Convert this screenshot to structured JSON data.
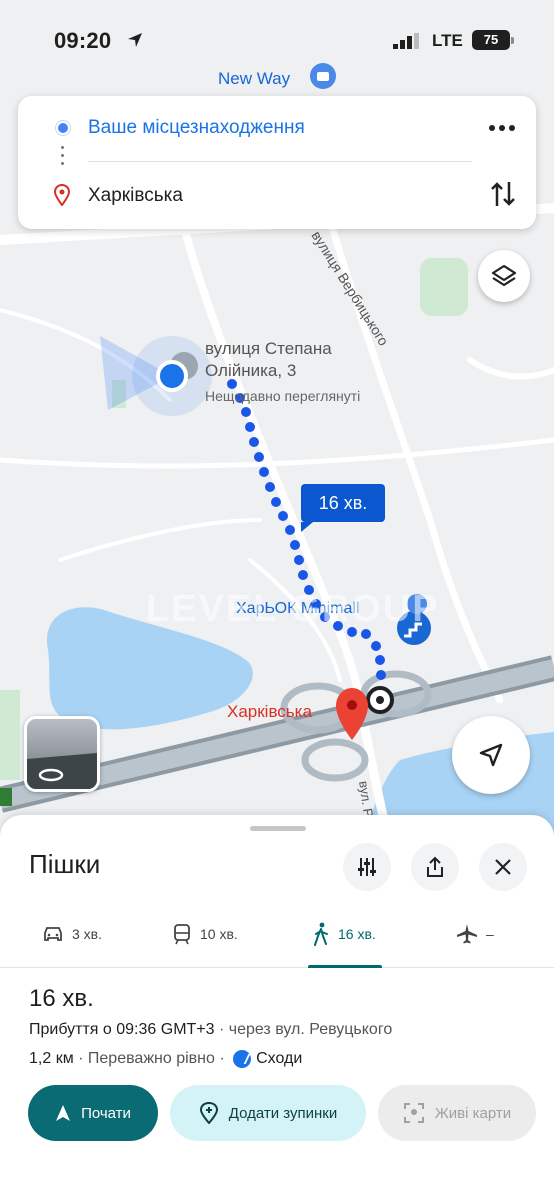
{
  "status_bar": {
    "time": "09:20",
    "network": "LTE",
    "battery": "75"
  },
  "map": {
    "poi_new_way": "New Way",
    "street_top": "вулиця Вербицького",
    "place_name_line1": "вулиця Степана",
    "place_name_line2": "Олійника, 3",
    "place_sub": "Нещодавно переглянуті",
    "eta_bubble": "16 хв.",
    "mall": "ХарЬОК Minimall",
    "destination_label": "Харківська",
    "street_bottom": "вул. Р",
    "watermark": "LEVEL GROUP",
    "icons": [
      "layers-icon",
      "my-location-arrow-icon",
      "street-view-icon",
      "stairs-icon",
      "metro-icon"
    ]
  },
  "route_card": {
    "from": "Ваше місцезнаходження",
    "to": "Харківська"
  },
  "sheet": {
    "title": "Пішки",
    "modes": [
      {
        "name": "car",
        "label": "3 хв."
      },
      {
        "name": "transit",
        "label": "10 хв."
      },
      {
        "name": "walk",
        "label": "16 хв."
      },
      {
        "name": "flight",
        "label": "–"
      }
    ],
    "selected_mode": "walk",
    "duration": "16 хв.",
    "arrival_prefix": "Прибуття о 09:36 GMT+3",
    "via": " · через вул. Ревуцького",
    "distance": "1,2 км",
    "terrain": " · Переважно рівно · ",
    "stairs": "Сходи",
    "buttons": {
      "start": "Почати",
      "add_stops": "Додати зупинки",
      "live_view": "Живі карти"
    }
  },
  "colors": {
    "accent_teal": "#0b6b74",
    "route_blue": "#1a56e8",
    "pin_red": "#d93025"
  }
}
